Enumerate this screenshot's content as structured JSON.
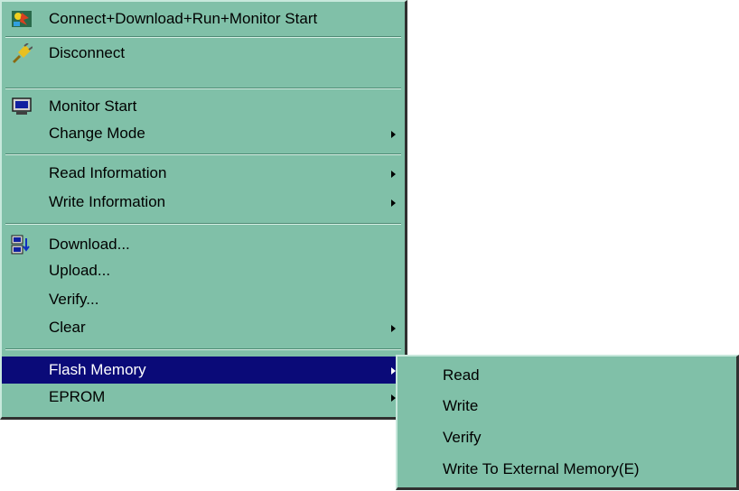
{
  "main_menu": {
    "items": [
      {
        "label": "Connect+Download+Run+Monitor Start",
        "icon": "connect-run-icon"
      },
      {
        "label": "Disconnect",
        "icon": "disconnect-plug-icon"
      },
      {
        "label": "Monitor Start",
        "icon": "monitor-icon"
      },
      {
        "label": "Change Mode"
      },
      {
        "label": "Read Information"
      },
      {
        "label": "Write Information"
      },
      {
        "label": "Download...",
        "icon": "download-icon"
      },
      {
        "label": "Upload..."
      },
      {
        "label": "Verify..."
      },
      {
        "label": "Clear"
      },
      {
        "label": "Flash Memory"
      },
      {
        "label": "EPROM"
      }
    ]
  },
  "submenu": {
    "items": [
      {
        "label": "Read"
      },
      {
        "label": "Write"
      },
      {
        "label": "Verify"
      },
      {
        "label": "Write To External Memory(E)"
      }
    ]
  },
  "colors": {
    "menu_bg": "#80c0a8",
    "highlight_bg": "#0a0a78",
    "highlight_text": "#ffffff"
  }
}
